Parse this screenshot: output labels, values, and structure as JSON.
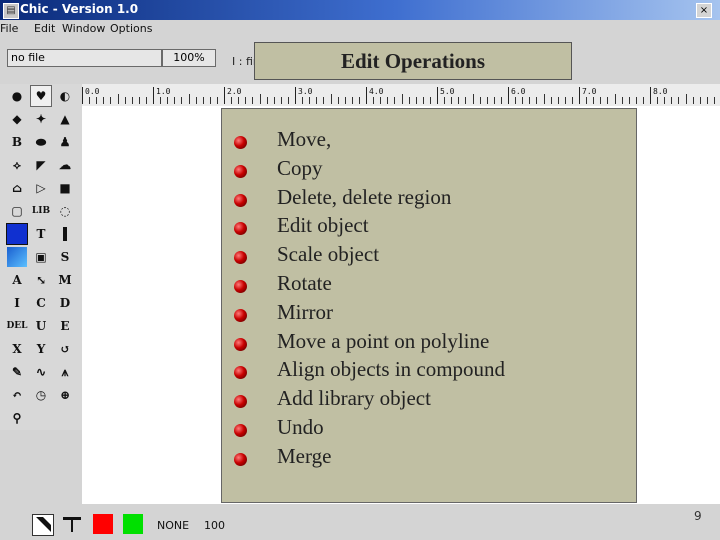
{
  "window": {
    "title": "Chic - Version 1.0",
    "close_glyph": "×",
    "app_icon": "app-icon"
  },
  "menu": [
    "File",
    "Edit",
    "Window",
    "Options"
  ],
  "toolbar": {
    "file_value": "no file",
    "zoom": "100%",
    "prompt": "I : fir"
  },
  "ruler": {
    "labels": [
      "0.0",
      "1.0",
      "2.0",
      "3.0",
      "4.0",
      "5.0",
      "6.0",
      "7.0",
      "8.0",
      "9"
    ]
  },
  "palette": {
    "tools": [
      {
        "name": "ellipse-tool-icon",
        "glyph": "●"
      },
      {
        "name": "heart-tool-icon",
        "glyph": "♥"
      },
      {
        "name": "moon-tool-icon",
        "glyph": "◐"
      },
      {
        "name": "drop-tool-icon",
        "glyph": "◆"
      },
      {
        "name": "leaf-tool-icon",
        "glyph": "✦"
      },
      {
        "name": "cone-tool-icon",
        "glyph": "▲"
      },
      {
        "name": "bold-tool-icon",
        "glyph": "B"
      },
      {
        "name": "blob-tool-icon",
        "glyph": "⬬"
      },
      {
        "name": "flask-tool-icon",
        "glyph": "♟"
      },
      {
        "name": "mirror-tool-icon",
        "glyph": "⟡"
      },
      {
        "name": "pen-tool-icon",
        "glyph": "◤"
      },
      {
        "name": "cloud-tool-icon",
        "glyph": "☁"
      },
      {
        "name": "house-tool-icon",
        "glyph": "⌂"
      },
      {
        "name": "play-tool-icon",
        "glyph": "▷"
      },
      {
        "name": "square-tool-icon",
        "glyph": "■"
      },
      {
        "name": "rounded-rect-tool-icon",
        "glyph": "▢"
      },
      {
        "name": "library-tool-icon",
        "glyph": "LIB"
      },
      {
        "name": "dashed-circle-tool-icon",
        "glyph": "◌"
      },
      {
        "name": "blue-fill-tool-icon",
        "glyph": ""
      },
      {
        "name": "text-tool-icon",
        "glyph": "T"
      },
      {
        "name": "slot-tool-icon",
        "glyph": ""
      },
      {
        "name": "color-tool-icon",
        "glyph": ""
      },
      {
        "name": "picture-tool-icon",
        "glyph": "▣"
      },
      {
        "name": "s-tool-icon",
        "glyph": "S"
      },
      {
        "name": "a-tool-icon",
        "glyph": "A"
      },
      {
        "name": "arrow-box-tool-icon",
        "glyph": "⤡"
      },
      {
        "name": "m-tool-icon",
        "glyph": "M"
      },
      {
        "name": "i-tool-icon",
        "glyph": "I"
      },
      {
        "name": "c-tool-icon",
        "glyph": "C"
      },
      {
        "name": "d-tool-icon",
        "glyph": "D"
      },
      {
        "name": "del-tool-icon",
        "glyph": "DEL"
      },
      {
        "name": "u-tool-icon",
        "glyph": "U"
      },
      {
        "name": "e-tool-icon",
        "glyph": "E"
      },
      {
        "name": "x-tool-icon",
        "glyph": "X"
      },
      {
        "name": "y-tool-icon",
        "glyph": "Y"
      },
      {
        "name": "rotate-tool-icon",
        "glyph": "↺"
      },
      {
        "name": "point-edit-tool-icon",
        "glyph": "✎"
      },
      {
        "name": "curve-tool-icon",
        "glyph": "∿"
      },
      {
        "name": "align-tool-icon",
        "glyph": "⩚"
      },
      {
        "name": "undo-tool-icon",
        "glyph": "↶"
      },
      {
        "name": "clock-tool-icon",
        "glyph": "◷"
      },
      {
        "name": "zoom-in-tool-icon",
        "glyph": "⊕"
      },
      {
        "name": "zoom-tool-icon",
        "glyph": "⚲"
      }
    ]
  },
  "slide": {
    "title": "Edit Operations",
    "items": [
      "Move,",
      "Copy",
      "Delete, delete region",
      "Edit object",
      "Scale object",
      "Rotate",
      "Mirror",
      "Move a point on polyline",
      "Align objects in compound",
      "Add library object",
      "Undo",
      "Merge"
    ],
    "page_number": "9"
  },
  "status": {
    "mode": "NONE",
    "value": "100",
    "colors": [
      "#ff0000",
      "#00e000"
    ]
  }
}
